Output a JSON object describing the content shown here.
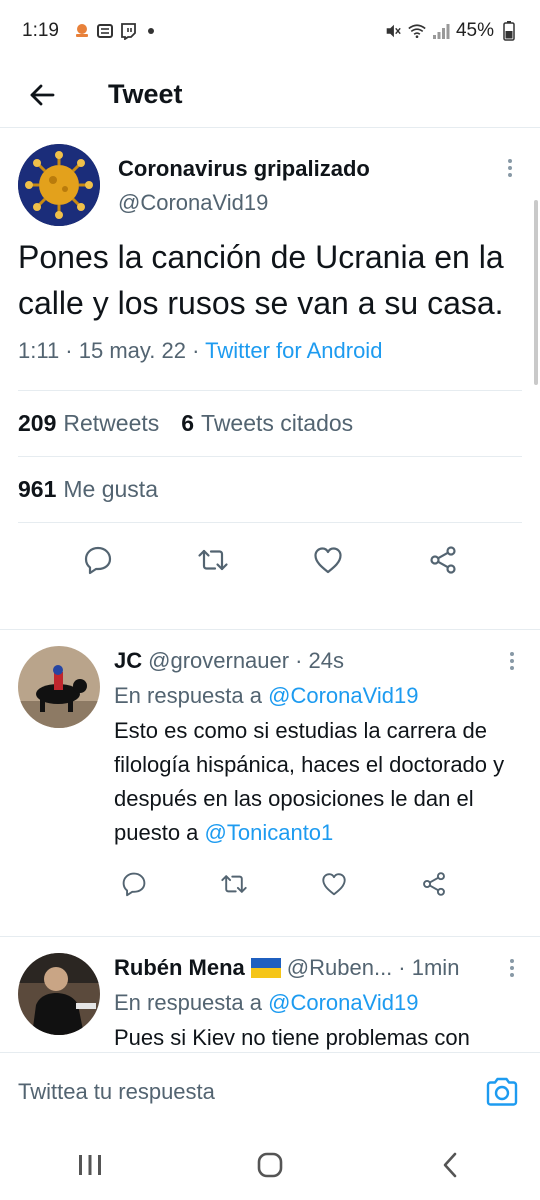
{
  "status_bar": {
    "time": "1:19",
    "battery": "45%"
  },
  "header": {
    "title": "Tweet"
  },
  "main_tweet": {
    "display_name": "Coronavirus gripalizado",
    "handle": "@CoronaVid19",
    "text": "Pones la canción de Ucrania en la calle y los rusos se van a su casa.",
    "time": "1:11",
    "date": "15 may. 22",
    "source": "Twitter for Android",
    "retweets_count": "209",
    "retweets_label": "Retweets",
    "quotes_count": "6",
    "quotes_label": "Tweets citados",
    "likes_count": "961",
    "likes_label": "Me gusta"
  },
  "replies": [
    {
      "display_name": "JC",
      "handle": "@grovernauer",
      "time": "24s",
      "reply_to_label": "En respuesta a",
      "reply_to": "@CoronaVid19",
      "text": "Esto es como si estudias la carrera de filología hispánica, haces el doctorado y después en las oposiciones le dan el puesto a",
      "mention": "@Tonicanto1"
    },
    {
      "display_name": "Rubén Mena",
      "handle": "@Ruben...",
      "time": "1min",
      "reply_to_label": "En respuesta a",
      "reply_to": "@CoronaVid19",
      "text": "Pues si Kiev no tiene problemas con"
    }
  ],
  "composer": {
    "placeholder": "Twittea tu respuesta"
  },
  "colors": {
    "accent": "#1d9bf0",
    "secondary_text": "#536471",
    "primary_text": "#0f1419",
    "divider": "#e6ecf0"
  },
  "icons": [
    "back-arrow-icon",
    "more-vertical-icon",
    "reply-icon",
    "retweet-icon",
    "like-icon",
    "share-icon",
    "camera-icon",
    "recents-icon",
    "home-icon",
    "nav-back-icon"
  ]
}
